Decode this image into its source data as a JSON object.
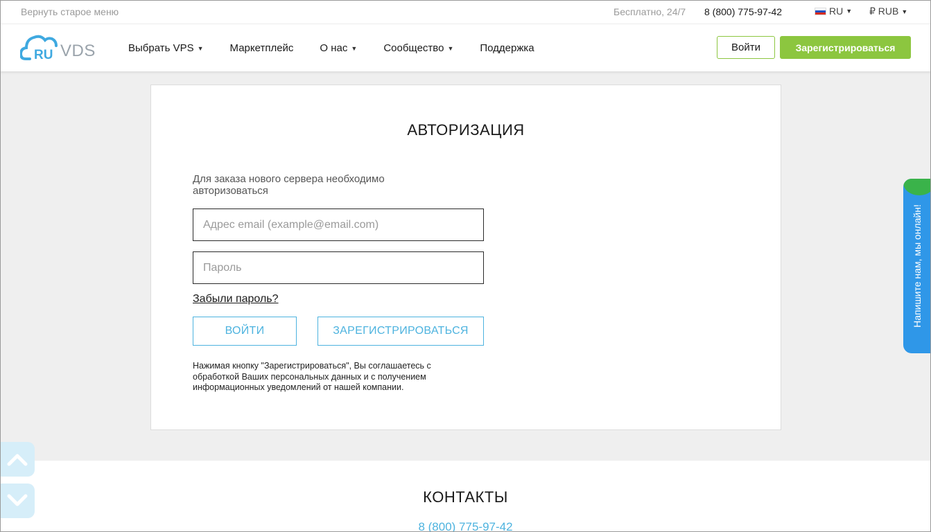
{
  "topbar": {
    "old_menu": "Вернуть старое меню",
    "free": "Бесплатно, 24/7",
    "phone": "8 (800) 775-97-42",
    "language": "RU",
    "currency": "₽ RUB"
  },
  "header": {
    "logo_ru": "RU",
    "logo_vds": "VDS",
    "nav": [
      {
        "label": "Выбрать VPS",
        "dropdown": true
      },
      {
        "label": "Маркетплейс",
        "dropdown": false
      },
      {
        "label": "О нас",
        "dropdown": true
      },
      {
        "label": "Сообщество",
        "dropdown": true
      },
      {
        "label": "Поддержка",
        "dropdown": false
      }
    ],
    "login_label": "Войти",
    "register_label": "Зарегистрироваться"
  },
  "auth": {
    "title": "АВТОРИЗАЦИЯ",
    "note": "Для заказа нового сервера необходимо авторизоваться",
    "email_placeholder": "Адрес email (example@email.com)",
    "email_value": "",
    "password_placeholder": "Пароль",
    "password_value": "",
    "forgot": "Забыли пароль?",
    "login_button": "ВОЙТИ",
    "register_button": "ЗАРЕГИСТРИРОВАТЬСЯ",
    "consent": "Нажимая кнопку \"Зарегистрироваться\", Вы соглашаетесь с обработкой Ваших персональных данных и с получением информационных уведомлений от нашей компании."
  },
  "contacts": {
    "title": "КОНТАКТЫ",
    "phone": "8 (800) 775-97-42"
  },
  "chat": {
    "label": "Напишите нам, мы онлайн!"
  },
  "icons": {
    "scroll_up": "chevron-up-icon",
    "scroll_down": "chevron-down-icon",
    "dropdown": "caret-down-icon",
    "flag": "russia-flag-icon",
    "logo": "cloud-logo-icon"
  },
  "colors": {
    "accent_green": "#8cc63f",
    "accent_blue": "#4db3df",
    "chat_blue": "#2f97e8",
    "chat_green": "#3ab34a",
    "logo_blue": "#3fa9e0",
    "background": "#efefef"
  }
}
